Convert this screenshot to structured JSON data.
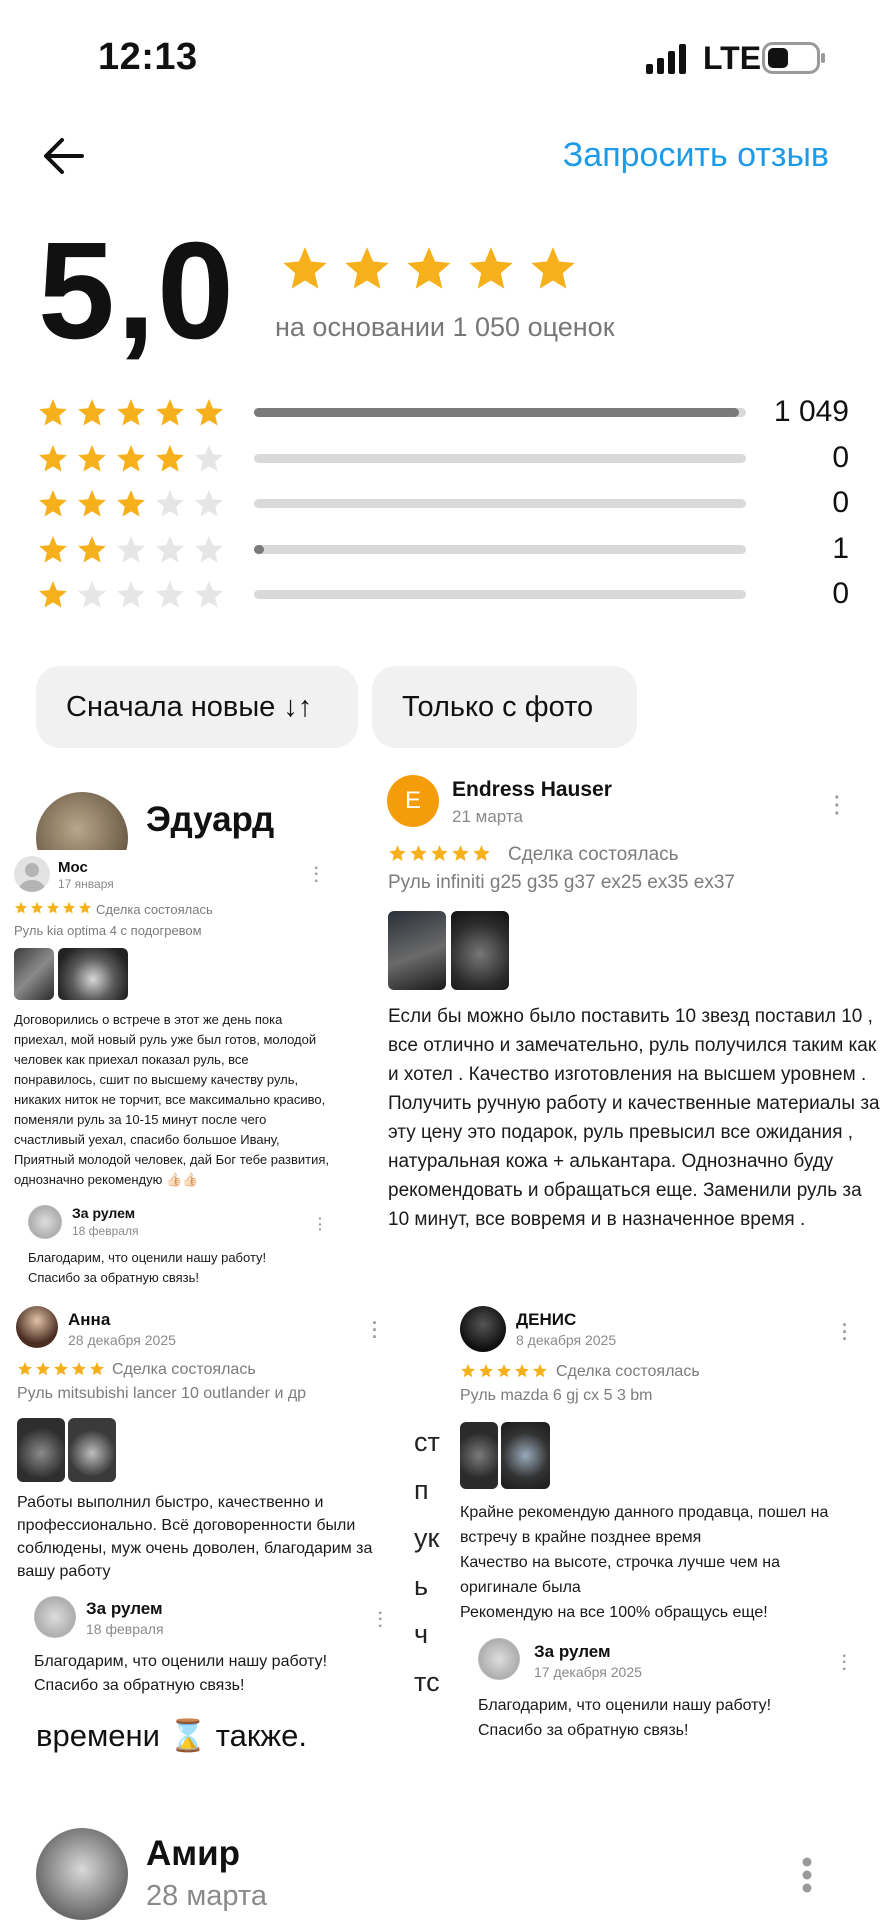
{
  "status_bar": {
    "time": "12:13",
    "network": "LTE"
  },
  "header": {
    "request_review": "Запросить отзыв"
  },
  "rating": {
    "value": "5,0",
    "stars": 5,
    "based_on": "на основании 1 050 оценок",
    "distribution": [
      {
        "stars": 5,
        "count": "1 049",
        "fraction": 0.985
      },
      {
        "stars": 4,
        "count": "0",
        "fraction": 0
      },
      {
        "stars": 3,
        "count": "0",
        "fraction": 0
      },
      {
        "stars": 2,
        "count": "1",
        "fraction": 0.015
      },
      {
        "stars": 1,
        "count": "0",
        "fraction": 0
      }
    ]
  },
  "filters": {
    "sort": "Сначала новые ↓↑",
    "photo_only": "Только с фото"
  },
  "background_review": {
    "name": "Эдуард",
    "snippet": "времени ⌛ также."
  },
  "bottom_review": {
    "name": "Амир",
    "date": "28 марта"
  },
  "collage": {
    "mos": {
      "name": "Мос",
      "date": "17 января",
      "deal": "Сделка состоялась",
      "item": "Руль kia optima 4 с подогревом",
      "text": "Договорились о встрече в этот же день пока приехал, мой новый руль уже был готов, молодой человек как приехал показал руль, все понравилось, сшит по высшему качеству руль, никаких ниток не торчит, все максимально красиво, поменяли руль за 10-15 минут после чего счастливый уехал, спасибо большое Ивану, Приятный молодой человек, дай Бог тебе развития, однозначно рекомендую 👍🏻👍🏻",
      "reply_name": "За рулем",
      "reply_date": "18 февраля",
      "reply_text": "Благодарим, что оценили нашу работу!\nСпасибо за обратную связь!"
    },
    "endress": {
      "initial": "E",
      "name": "Endress Hauser",
      "date": "21 марта",
      "deal": "Сделка состоялась",
      "item": "Руль infiniti g25 g35 g37 ex25 ex35 ex37",
      "text": "Если бы можно было поставить 10 звезд поставил 10 , все отлично и замечательно, руль получился таким как и хотел . Качество изготовления на высшем уровнем . Получить ручную работу и качественные материалы за эту цену это подарок, руль превысил все ожидания , натуральная кожа + алькантара.  Однозначно буду рекомендовать и обращаться еще. Заменили руль за 10 минут, все вовремя и в назначенное время ."
    },
    "anna": {
      "name": "Анна",
      "date": "28 декабря 2025",
      "deal": "Сделка состоялась",
      "item": "Руль mitsubishi lancer 10 outlander и др",
      "text": "Работы выполнил быстро, качественно и профессионально. Всё договоренности были соблюдены, муж очень доволен, благодарим за вашу работу",
      "reply_name": "За рулем",
      "reply_date": "18 февраля",
      "reply_text": "Благодарим, что оценили нашу работу!\nСпасибо за обратную связь!"
    },
    "denis": {
      "name": "ДЕНИС",
      "date": "8 декабря 2025",
      "deal": "Сделка состоялась",
      "item": "Руль mazda 6 gj cx 5 3 bm",
      "text": "Крайне рекомендую данного продавца, пошел на встречу в крайне позднее время\nКачество на высоте, строчка лучше чем на оригинале была\nРекомендую на все 100% обращусь еще!",
      "reply_name": "За рулем",
      "reply_date": "17 декабря 2025",
      "reply_text": "Благодарим, что оценили нашу работу!\nСпасибо за обратную связь!"
    },
    "bg_fragments": [
      "ст",
      "п",
      "ук",
      "ь",
      "ч",
      "тс"
    ]
  },
  "colors": {
    "star": "#f5b01c",
    "link": "#1e9be8",
    "endress_avatar": "#f59c0b"
  }
}
